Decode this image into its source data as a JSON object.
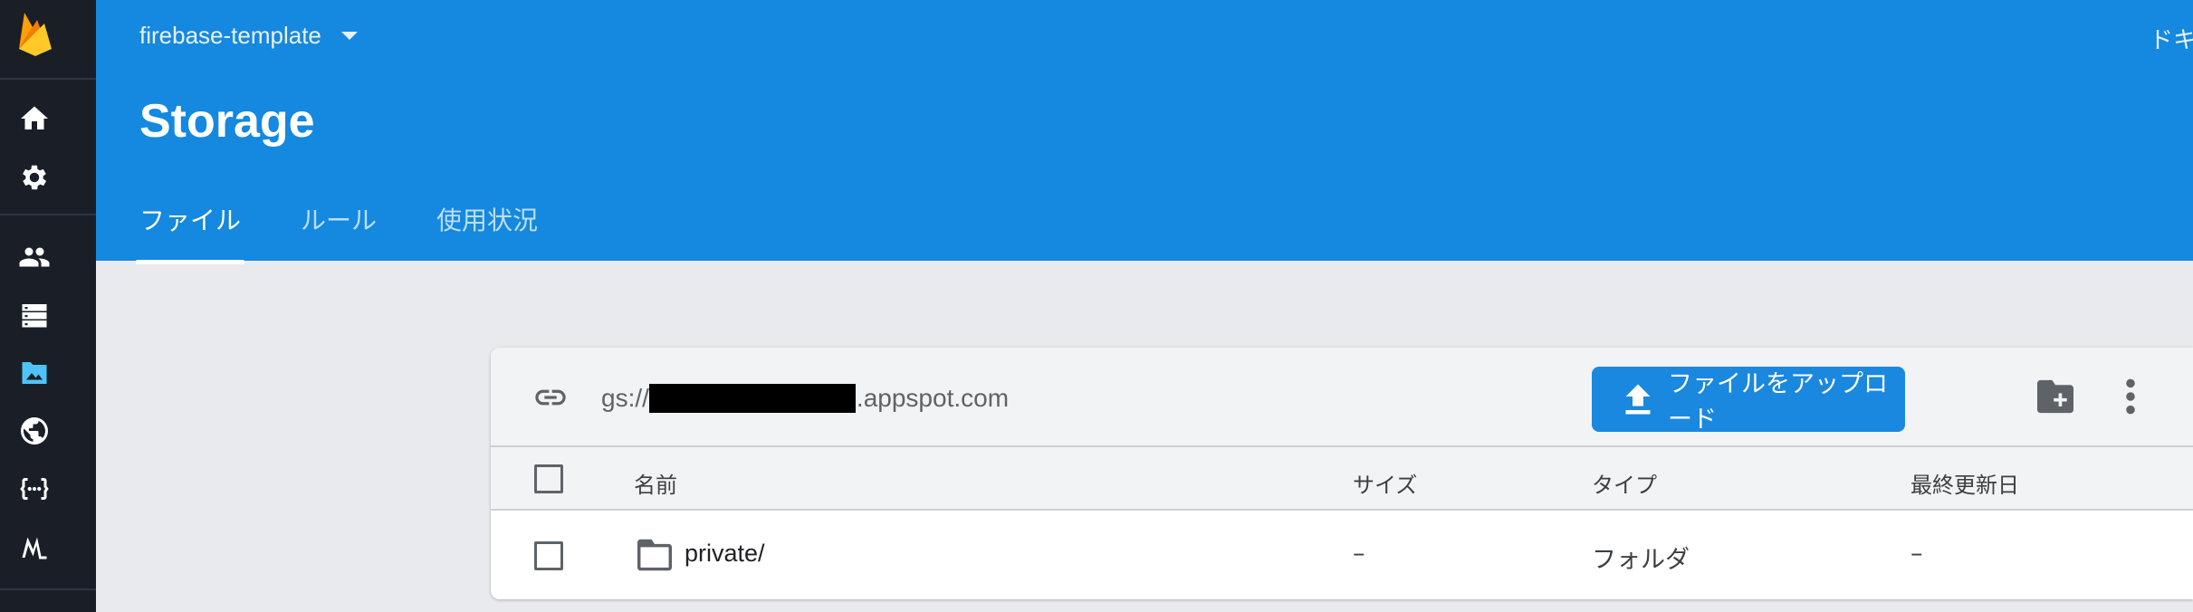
{
  "header": {
    "project_name": "firebase-template",
    "top_right_text": "ドキ",
    "page_title": "Storage",
    "tabs": [
      {
        "label": "ファイル",
        "active": true
      },
      {
        "label": "ルール",
        "active": false
      },
      {
        "label": "使用状況",
        "active": false
      }
    ]
  },
  "rail": {
    "items": [
      "firebase-logo",
      "home-icon",
      "settings-icon",
      "users-icon",
      "database-icon",
      "storage-icon",
      "hosting-icon",
      "functions-icon",
      "mlkit-icon"
    ],
    "active": "storage-icon"
  },
  "toolbar": {
    "bucket_prefix": "gs://",
    "bucket_suffix": ".appspot.com",
    "upload_label": "ファイルをアップロード"
  },
  "table": {
    "columns": [
      "名前",
      "サイズ",
      "タイプ",
      "最終更新日"
    ],
    "rows": [
      {
        "name": "private/",
        "size": "–",
        "type": "フォルダ",
        "modified": "–"
      }
    ]
  },
  "colors": {
    "header_bg": "#1588df",
    "rail_bg": "#1a1f27",
    "accent": "#1a88df",
    "page_bg": "#e8eaed"
  }
}
